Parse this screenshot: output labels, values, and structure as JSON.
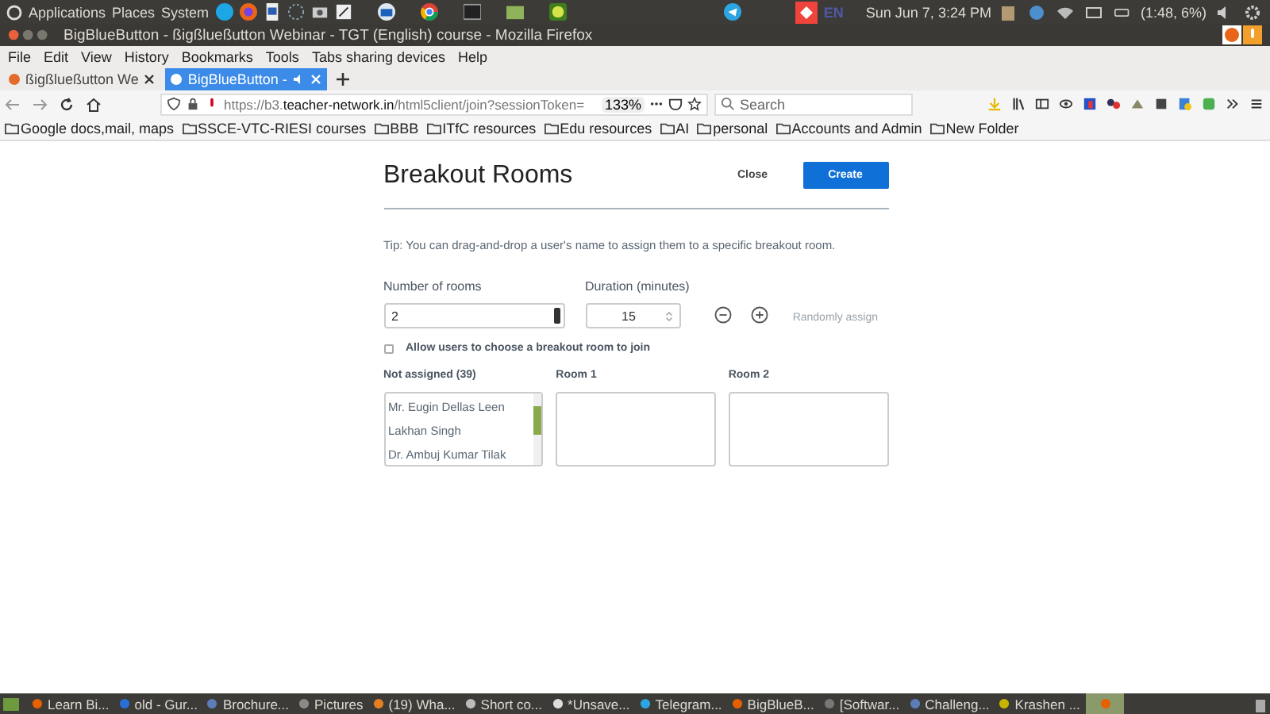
{
  "top_panel": {
    "menus": [
      "Applications",
      "Places",
      "System"
    ],
    "keyboard": "EN",
    "clock": "Sun Jun  7,  3:24 PM",
    "battery": "(1:48, 6%)"
  },
  "window": {
    "title": "BigBlueButton - ßigßlueßutton Webinar - TGT (English) course - Mozilla Firefox"
  },
  "menu_bar": [
    "File",
    "Edit",
    "View",
    "History",
    "Bookmarks",
    "Tools",
    "Tabs sharing devices",
    "Help"
  ],
  "tabs": [
    {
      "label": "ßigßlueßutton We",
      "selected": false
    },
    {
      "label": "BigBlueButton -",
      "selected": true
    }
  ],
  "address": {
    "url": "https://b3.**teacher-network.in**/html5client/join?sessionToken=",
    "zoom": "133%"
  },
  "search": {
    "placeholder": "Search"
  },
  "bookmarks": [
    "Google docs,mail, maps",
    "SSCE-VTC-RIESI courses",
    "BBB",
    "ITfC resources",
    "Edu resources",
    "AI",
    "personal",
    "Accounts and Admin",
    "New Folder"
  ],
  "breakout": {
    "title": "Breakout Rooms",
    "close": "Close",
    "create": "Create",
    "tip": "Tip: You can drag-and-drop a user's name to assign them to a specific breakout room.",
    "rooms_label": "Number of rooms",
    "rooms_value": "2",
    "duration_label": "Duration (minutes)",
    "duration_value": "15",
    "randomly_assign": {
      "label": "Randomly assign",
      "disabled": true
    },
    "allow_choose": {
      "label": "Allow users to choose a breakout room to join",
      "checked": false
    },
    "columns": [
      {
        "title": "Not assigned (39)",
        "users": [
          "Mr. Eugin Dellas Leen",
          "Lakhan Singh",
          "Dr. Ambuj Kumar Tilak"
        ]
      },
      {
        "title": "Room 1"
      },
      {
        "title": "Room 2"
      }
    ]
  },
  "taskbar": [
    {
      "label": "Learn Bi...",
      "selected": false
    },
    {
      "label": "old - Gur...",
      "selected": false
    },
    {
      "label": "Brochure...",
      "selected": false
    },
    {
      "label": "Pictures",
      "selected": false
    },
    {
      "label": "(19) Wha...",
      "selected": false
    },
    {
      "label": "Short co...",
      "selected": false
    },
    {
      "label": "*Unsave...",
      "selected": false
    },
    {
      "label": "Telegram...",
      "selected": false
    },
    {
      "label": "BigBlueB...",
      "selected": false
    },
    {
      "label": "[Softwar...",
      "selected": false
    },
    {
      "label": "Challeng...",
      "selected": false
    },
    {
      "label": "Krashen ...",
      "selected": false
    },
    {
      "selected": true
    }
  ]
}
